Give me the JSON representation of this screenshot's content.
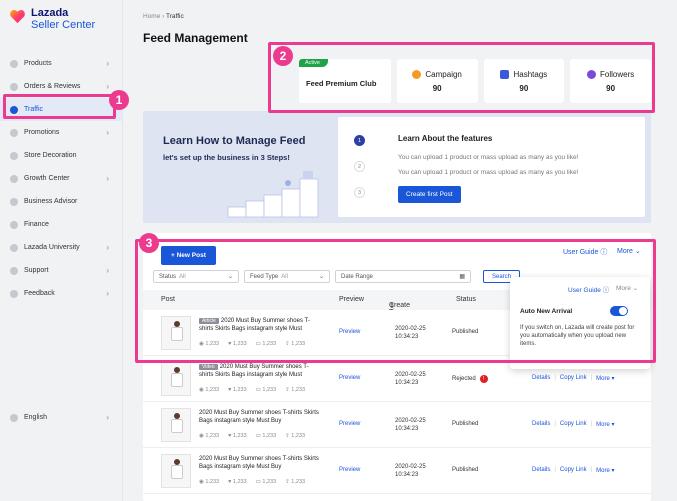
{
  "brand": {
    "name": "Lazada",
    "subtitle": "Seller Center"
  },
  "sidebar": {
    "items": [
      {
        "label": "Products"
      },
      {
        "label": "Orders & Reviews"
      },
      {
        "label": "Traffic"
      },
      {
        "label": "Promotions"
      },
      {
        "label": "Store Decoration"
      },
      {
        "label": "Growth Center"
      },
      {
        "label": "Business Advisor"
      },
      {
        "label": "Finance"
      },
      {
        "label": "Lazada University"
      },
      {
        "label": "Support"
      },
      {
        "label": "Feedback"
      }
    ],
    "language": "English"
  },
  "breadcrumb": {
    "home": "Home",
    "current": "Traffic"
  },
  "page_title": "Feed Management",
  "stats": {
    "club": {
      "badge": "Active",
      "name": "Feed Premium Club"
    },
    "items": [
      {
        "label": "Campaign",
        "value": "90"
      },
      {
        "label": "Hashtags",
        "value": "90"
      },
      {
        "label": "Followers",
        "value": "90"
      }
    ]
  },
  "learn": {
    "title": "Learn How to Manage Feed",
    "subtitle": "let's set up the business in 3 Steps!",
    "card_title": "Learn About the features",
    "steps": [
      "1",
      "2",
      "3"
    ],
    "desc1": "You can upload 1 product or mass upload as many as you like!",
    "desc2": "You can upload 1 product or mass upload as many as you like!",
    "cta": "Create first Post"
  },
  "feed": {
    "new_post": "+ New Post",
    "user_guide": "User Guide",
    "more": "More",
    "filters": {
      "status_label": "Status",
      "status_value": "All",
      "feed_type_label": "Feed Type",
      "feed_type_value": "All",
      "date_placeholder": "Date Range",
      "search": "Search"
    },
    "columns": {
      "post": "Post",
      "preview": "Preview",
      "create_time": "Create Time",
      "status": "Status"
    },
    "rows": [
      {
        "tag": "Article",
        "title": "2020 Must Buy Summer shoes T-shirts Skirts Bags instagram style Must",
        "m1": "1,233",
        "m2": "1,233",
        "m3": "1,233",
        "m4": "1,233",
        "preview": "Preview",
        "date": "2020-02-25",
        "time": "10:34:23",
        "status": "Published"
      },
      {
        "tag": "Video",
        "title": "2020 Must Buy Summer shoes T-shirts Skirts Bags instagram style Must",
        "m1": "1,233",
        "m2": "1,233",
        "m3": "1,233",
        "m4": "1,233",
        "preview": "Preview",
        "date": "2020-02-25",
        "time": "10:34:23",
        "status": "Rejected",
        "details": "Details",
        "copy": "Copy Link",
        "more": "More"
      },
      {
        "title": "2020 Must Buy Summer shoes T-shirts Skirts Bags instagram style Must Buy",
        "m1": "1,233",
        "m2": "1,233",
        "m3": "1,233",
        "m4": "1,233",
        "preview": "Preview",
        "date": "2020-02-25",
        "time": "10:34:23",
        "status": "Published",
        "details": "Details",
        "copy": "Copy Link",
        "more": "More"
      },
      {
        "title": "2020 Must Buy Summer shoes T-shirts Skirts Bags instagram style Must Buy",
        "m1": "1,233",
        "m2": "1,233",
        "m3": "1,233",
        "m4": "1,233",
        "preview": "Preview",
        "date": "2020-02-25",
        "time": "10:34:23",
        "status": "Published",
        "details": "Details",
        "copy": "Copy Link",
        "more": "More"
      }
    ]
  },
  "popover": {
    "user_guide": "User Guide",
    "more": "More",
    "auto_title": "Auto New Arrival",
    "desc": "If you switch on, Lazada will create post for you automatically when you upload new items."
  },
  "annotations": {
    "m1": "1",
    "m2": "2",
    "m3": "3"
  },
  "colors": {
    "accent": "#1a56d8",
    "callout": "#ec3b8e",
    "active_badge": "#1fa34a",
    "rejected": "#e02020"
  }
}
